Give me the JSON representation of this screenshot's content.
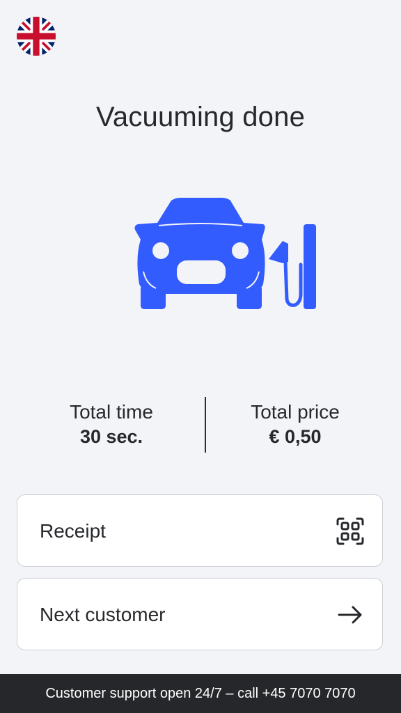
{
  "language": {
    "icon": "uk-flag-icon",
    "code": "EN"
  },
  "header": {
    "title": "Vacuuming done"
  },
  "illustration": {
    "icon": "car-vacuum-icon",
    "color": "#335cff"
  },
  "summary": {
    "time_label": "Total time",
    "time_value": "30 sec.",
    "price_label": "Total price",
    "price_value": "€ 0,50"
  },
  "actions": {
    "receipt_label": "Receipt",
    "receipt_icon": "qr-code-icon",
    "next_label": "Next customer",
    "next_icon": "arrow-right-icon"
  },
  "footer": {
    "text": "Customer support open 24/7 – call +45 7070 7070"
  },
  "colors": {
    "accent": "#335cff",
    "background": "#f3f4f8",
    "footer_bg": "#26272a"
  }
}
